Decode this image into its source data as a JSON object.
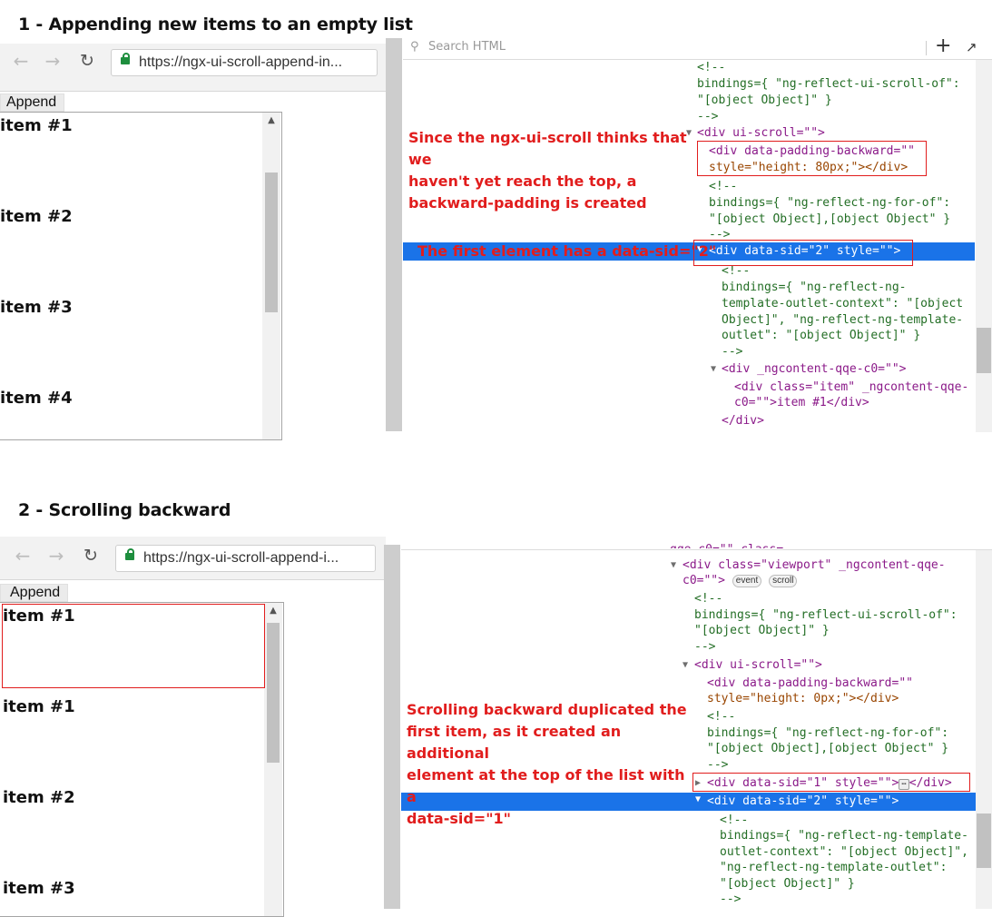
{
  "sections": [
    {
      "title": "1 - Appending new items to an empty list",
      "browser": {
        "url": "https://ngx-ui-scroll-append-in...",
        "append_label": "Append"
      },
      "items": [
        "item #1",
        "item #2",
        "item #3",
        "item #4"
      ],
      "devtools": {
        "search_placeholder": "Search HTML",
        "lines": [
          "<!--",
          "bindings={ \"ng-reflect-ui-scroll-of\":",
          "\"[object Object]\" }",
          "-->",
          "<div ui-scroll=\"\">",
          "<div data-padding-backward=\"\"",
          "style=\"height: 80px;\"></div>",
          "<!--",
          "bindings={ \"ng-reflect-ng-for-of\":",
          "\"[object Object],[object Object\" }",
          "-->",
          "<div data-sid=\"2\" style=\"\">",
          "<!--",
          "bindings={ \"ng-reflect-ng-",
          "template-outlet-context\": \"[object",
          "Object]\", \"ng-reflect-ng-template-",
          "outlet\": \"[object Object]\" }",
          "-->",
          "<div _ngcontent-qqe-c0=\"\">",
          "<div class=\"item\" _ngcontent-qqe-",
          "c0=\"\">item #1</div>",
          "</div>"
        ]
      },
      "annotations": {
        "note": [
          "Since the ngx-ui-scroll thinks that we",
          "haven't yet reach the top, a",
          "backward-padding is created"
        ],
        "highlight_note": "The first element has a data-sid=\"2\""
      }
    },
    {
      "title": "2 - Scrolling backward",
      "browser": {
        "url": "https://ngx-ui-scroll-append-i...",
        "append_label": "Append"
      },
      "items": [
        "item #1",
        "item #1",
        "item #2",
        "item #3"
      ],
      "devtools": {
        "top_fragment": "qqe-c0=\"\" class=",
        "badges": [
          "event",
          "scroll"
        ],
        "lines": [
          "<div class=\"viewport\" _ngcontent-qqe-",
          "c0=\"\">",
          "<!--",
          "bindings={ \"ng-reflect-ui-scroll-of\":",
          "\"[object Object]\" }",
          "-->",
          "<div ui-scroll=\"\">",
          "<div data-padding-backward=\"\"",
          "style=\"height: 0px;\"></div>",
          "<!--",
          "bindings={ \"ng-reflect-ng-for-of\":",
          "\"[object Object],[object Object\" }",
          "-->",
          "<div data-sid=\"1\" style=\"\">",
          "</div>",
          "<div data-sid=\"2\" style=\"\">",
          "<!--",
          "bindings={ \"ng-reflect-ng-template-",
          "outlet-context\": \"[object Object]\",",
          "\"ng-reflect-ng-template-outlet\":",
          "\"[object Object]\" }",
          "-->"
        ],
        "ellipsis": "⋯"
      },
      "annotations": {
        "note": [
          "Scrolling backward duplicated the",
          "first item, as it created an additional",
          "element at the top of the list with a",
          "data-sid=\"1\""
        ]
      }
    }
  ],
  "icons": {
    "back": "←",
    "forward": "→",
    "reload": "↻",
    "search": "⚲",
    "add": "+",
    "picker": "↗",
    "scroll_up": "▲",
    "expanded": "▼",
    "collapsed": "▶"
  },
  "colors": {
    "annotation_red": "#e11d1d",
    "selection_blue": "#1a73e8",
    "tag": "#8b1a89",
    "attribute": "#994500",
    "value": "#1a1aa6",
    "comment": "#236e25"
  }
}
